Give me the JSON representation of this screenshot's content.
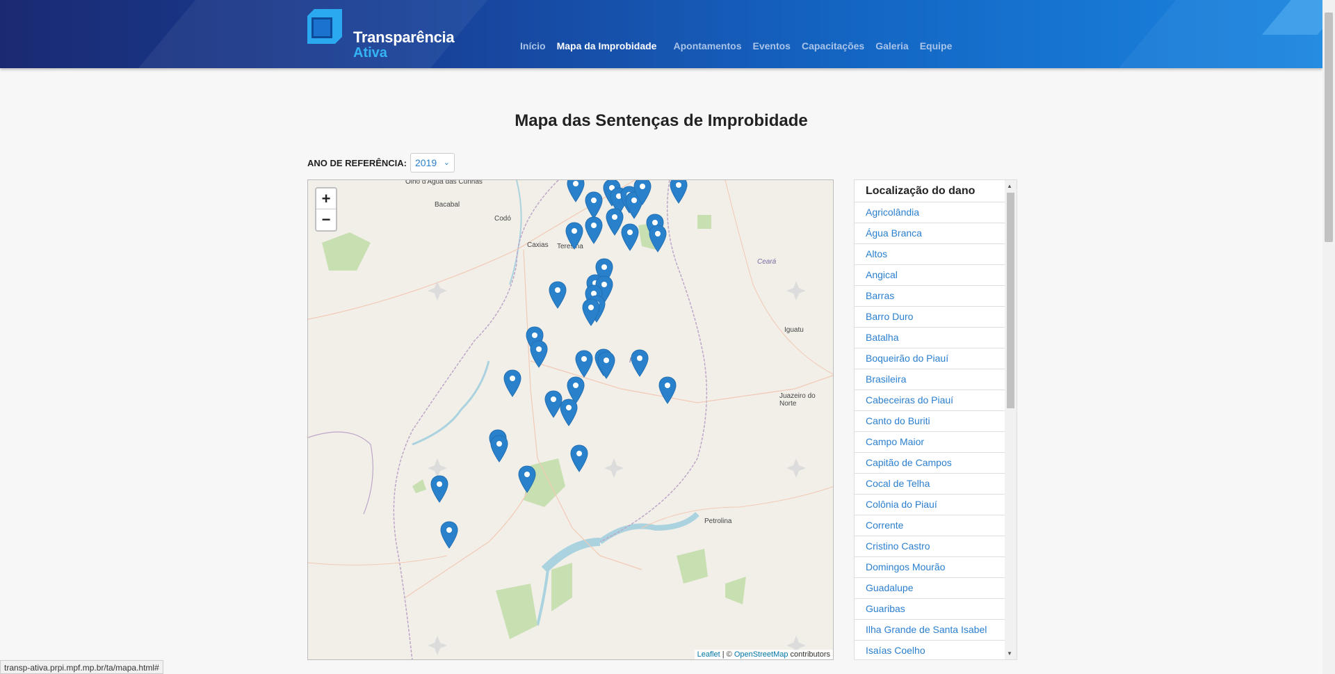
{
  "header": {
    "logo_line1": "Transparência",
    "logo_line2": "Ativa",
    "nav": [
      {
        "label": "Início",
        "active": false
      },
      {
        "label": "Mapa da Improbidade",
        "active": true
      },
      {
        "label": "Apontamentos",
        "active": false
      },
      {
        "label": "Eventos",
        "active": false
      },
      {
        "label": "Capacitações",
        "active": false
      },
      {
        "label": "Galeria",
        "active": false
      },
      {
        "label": "Equipe",
        "active": false
      }
    ]
  },
  "page_title": "Mapa das Sentenças de Improbidade",
  "year_filter": {
    "label": "ANO DE REFERÊNCIA:",
    "value": "2019"
  },
  "map": {
    "zoom_in": "+",
    "zoom_out": "−",
    "attribution_leaflet": "Leaflet",
    "attribution_sep": " | © ",
    "attribution_osm": "OpenStreetMap",
    "attribution_suffix": " contributors",
    "place_labels": [
      "Olho d'Água das Cunhãs",
      "Bacabal",
      "Codó",
      "Caxias",
      "Teresina",
      "Ceará",
      "Iguatu",
      "Piauí",
      "Juazeiro do Norte",
      "Petrolina"
    ],
    "marker_color": "#2a81cb"
  },
  "list": {
    "title": "Localização do dano",
    "items": [
      "Agricolândia",
      "Água Branca",
      "Altos",
      "Angical",
      "Barras",
      "Barro Duro",
      "Batalha",
      "Boqueirão do Piauí",
      "Brasileira",
      "Cabeceiras do Piauí",
      "Canto do Buriti",
      "Campo Maior",
      "Capitão de Campos",
      "Cocal de Telha",
      "Colônia do Piauí",
      "Corrente",
      "Cristino Castro",
      "Domingos Mourão",
      "Guadalupe",
      "Guaribas",
      "Ilha Grande de Santa Isabel",
      "Isaías Coelho"
    ]
  },
  "statusbar": "transp-ativa.prpi.mpf.mp.br/ta/mapa.html#"
}
